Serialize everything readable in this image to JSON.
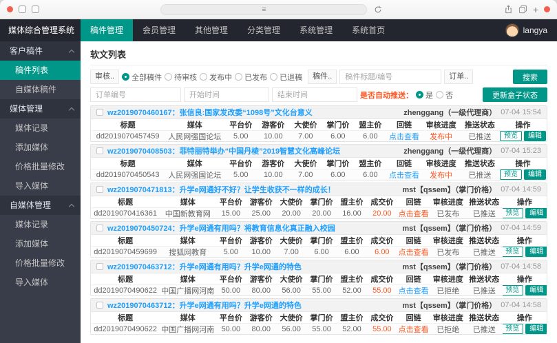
{
  "colors": {
    "accent_green": "#009688",
    "link_blue": "#1e9fff",
    "alert_red": "#ff5722",
    "nav_dark": "#23262e",
    "sidebar_dark": "#393d49"
  },
  "browser": {
    "menu_glyph": "≡",
    "plus_glyph": "+"
  },
  "navbar": {
    "title": "媒体综合管理系统",
    "items": [
      {
        "label": "稿件管理",
        "active": true
      },
      {
        "label": "会员管理",
        "active": false
      },
      {
        "label": "其他管理",
        "active": false
      },
      {
        "label": "分类管理",
        "active": false
      },
      {
        "label": "系统管理",
        "active": false
      },
      {
        "label": "系统首页",
        "active": false
      }
    ],
    "user": "langya"
  },
  "sidebar": {
    "items": [
      {
        "label": "客户稿件",
        "type": "header",
        "active": false
      },
      {
        "label": "稿件列表",
        "type": "item",
        "active": true
      },
      {
        "label": "自媒体稿件",
        "type": "item",
        "active": false
      },
      {
        "label": "媒体管理",
        "type": "header",
        "active": false
      },
      {
        "label": "媒体记录",
        "type": "item",
        "active": false
      },
      {
        "label": "添加媒体",
        "type": "item",
        "active": false
      },
      {
        "label": "价格批量修改",
        "type": "item",
        "active": false
      },
      {
        "label": "导入媒体",
        "type": "item",
        "active": false
      },
      {
        "label": "自媒体管理",
        "type": "header",
        "active": false
      },
      {
        "label": "媒体记录",
        "type": "item",
        "active": false
      },
      {
        "label": "添加媒体",
        "type": "item",
        "active": false
      },
      {
        "label": "价格批量修改",
        "type": "item",
        "active": false
      },
      {
        "label": "导入媒体",
        "type": "item",
        "active": false
      }
    ]
  },
  "main": {
    "page_title": "软文列表",
    "filters": {
      "audit_label": "审核..",
      "audit_options": [
        {
          "label": "全部稿件",
          "selected": true
        },
        {
          "label": "待审核",
          "selected": false
        },
        {
          "label": "发布中",
          "selected": false
        },
        {
          "label": "已发布",
          "selected": false
        },
        {
          "label": "已退稿",
          "selected": false
        }
      ],
      "title_label": "稿件..",
      "title_placeholder": "稿件标题/编号",
      "order_label": "订单..",
      "search_button": "搜索",
      "order_placeholder": "订单编号",
      "start_placeholder": "开始时间",
      "end_placeholder": "结束时间",
      "autopush_label": "是否自动推送：",
      "autopush_options": [
        {
          "label": "是",
          "selected": true
        },
        {
          "label": "否",
          "selected": false
        }
      ],
      "update_button": "更新盒子状态"
    },
    "cards": [
      {
        "title": "wz2019070460167：张信良:国家发改委“1098号”文化台意义",
        "agent": "zhenggang（一级代理商）",
        "time": "07-04 15:54",
        "columns": [
          "标题",
          "媒体",
          "平台价",
          "游客价",
          "大使价",
          "掌门价",
          "盟主价",
          "回链",
          "审核进度",
          "推送状态",
          "操作"
        ],
        "cells": [
          {
            "text": "dd2019070457459"
          },
          {
            "text": "人民网强国论坛"
          },
          {
            "text": "5.00"
          },
          {
            "text": "10.00"
          },
          {
            "text": "7.00"
          },
          {
            "text": "6.00"
          },
          {
            "text": "6.00"
          },
          {
            "text": "点击查看",
            "color": "#1e9fff",
            "link": true
          },
          {
            "text": "发布中",
            "color": "#ff5722"
          },
          {
            "text": "已推送"
          },
          {
            "actions": [
              "预览",
              "编辑"
            ]
          }
        ]
      },
      {
        "title": "wz2019070408503：菲特丽特举办“中国丹棱”2019智慧文化高峰论坛",
        "agent": "zhenggang（一级代理商）",
        "time": "07-04 15:23",
        "columns": [
          "标题",
          "媒体",
          "平台价",
          "游客价",
          "大使价",
          "掌门价",
          "盟主价",
          "回链",
          "审核进度",
          "推送状态",
          "操作"
        ],
        "cells": [
          {
            "text": "dd2019070450543"
          },
          {
            "text": "人民网强国论坛"
          },
          {
            "text": "5.00"
          },
          {
            "text": "10.00"
          },
          {
            "text": "7.00"
          },
          {
            "text": "6.00"
          },
          {
            "text": "6.00"
          },
          {
            "text": "点击查看",
            "color": "#1e9fff",
            "link": true
          },
          {
            "text": "发布中",
            "color": "#ff5722"
          },
          {
            "text": "已推送"
          },
          {
            "actions": [
              "预览",
              "编辑"
            ]
          }
        ]
      },
      {
        "title": "wz2019070471813：升学e网通好不好？让学生收获不一样的成长！",
        "agent": "mst【qssem】（掌门价格）",
        "time": "07-04 14:59",
        "columns": [
          "标题",
          "媒体",
          "平台价",
          "游客价",
          "大使价",
          "掌门价",
          "盟主价",
          "成交价",
          "回链",
          "审核进度",
          "推送状态",
          "操作"
        ],
        "cells": [
          {
            "text": "dd2019070416361"
          },
          {
            "text": "中国新教育网"
          },
          {
            "text": "15.00"
          },
          {
            "text": "25.00"
          },
          {
            "text": "20.00"
          },
          {
            "text": "20.00"
          },
          {
            "text": "16.00"
          },
          {
            "text": "20.00",
            "color": "#ff5722"
          },
          {
            "text": "点击查看",
            "color": "#ff5722",
            "link": true
          },
          {
            "text": "已发布"
          },
          {
            "text": "已推送"
          },
          {
            "actions": [
              "预览",
              "编辑"
            ]
          }
        ]
      },
      {
        "title": "wz2019070450724：升学e网通有用吗？将教育信息化真正融入校园",
        "agent": "mst【qssem】（掌门价格）",
        "time": "07-04 14:59",
        "columns": [
          "标题",
          "媒体",
          "平台价",
          "游客价",
          "大使价",
          "掌门价",
          "盟主价",
          "成交价",
          "回链",
          "审核进度",
          "推送状态",
          "操作"
        ],
        "cells": [
          {
            "text": "dd2019070459699"
          },
          {
            "text": "搜狐网教育"
          },
          {
            "text": "5.00"
          },
          {
            "text": "10.00"
          },
          {
            "text": "7.00"
          },
          {
            "text": "6.00"
          },
          {
            "text": "6.00"
          },
          {
            "text": "6.00",
            "color": "#ff5722"
          },
          {
            "text": "点击查看",
            "color": "#ff5722",
            "link": true
          },
          {
            "text": "已发布"
          },
          {
            "text": "已推送"
          },
          {
            "actions": [
              "预览",
              "编辑"
            ]
          }
        ]
      },
      {
        "title": "wz2019070463712：升学e网通有用吗？升学e网通的特色",
        "agent": "mst【qssem】（掌门价格）",
        "time": "07-04 14:58",
        "columns": [
          "标题",
          "媒体",
          "平台价",
          "游客价",
          "大使价",
          "掌门价",
          "盟主价",
          "成交价",
          "回链",
          "审核进度",
          "推送状态",
          "操作"
        ],
        "cells": [
          {
            "text": "dd2019070490622"
          },
          {
            "text": "中国广播网河南"
          },
          {
            "text": "50.00"
          },
          {
            "text": "80.00"
          },
          {
            "text": "56.00"
          },
          {
            "text": "55.00"
          },
          {
            "text": "52.00"
          },
          {
            "text": "55.00",
            "color": "#ff5722"
          },
          {
            "text": "点击查看",
            "color": "#1e9fff",
            "link": true
          },
          {
            "text": "已拒绝"
          },
          {
            "text": "已推送"
          },
          {
            "actions": [
              "预览",
              "编辑"
            ]
          }
        ]
      },
      {
        "title": "wz2019070463712：升学e网通有用吗？升学e网通的特色",
        "agent": "mst【qssem】（掌门价格）",
        "time": "07-04 14:58",
        "columns": [
          "标题",
          "媒体",
          "平台价",
          "游客价",
          "大使价",
          "掌门价",
          "盟主价",
          "成交价",
          "回链",
          "审核进度",
          "推送状态",
          "操作"
        ],
        "cells": [
          {
            "text": "dd2019070490622"
          },
          {
            "text": "中国广播网河南"
          },
          {
            "text": "50.00"
          },
          {
            "text": "80.00"
          },
          {
            "text": "56.00"
          },
          {
            "text": "55.00"
          },
          {
            "text": "52.00"
          },
          {
            "text": "55.00",
            "color": "#ff5722"
          },
          {
            "text": "点击查看",
            "color": "#ff5722",
            "link": true
          },
          {
            "text": "已拒绝"
          },
          {
            "text": "已推送"
          },
          {
            "actions": [
              "预览",
              "编辑"
            ]
          }
        ]
      }
    ]
  }
}
